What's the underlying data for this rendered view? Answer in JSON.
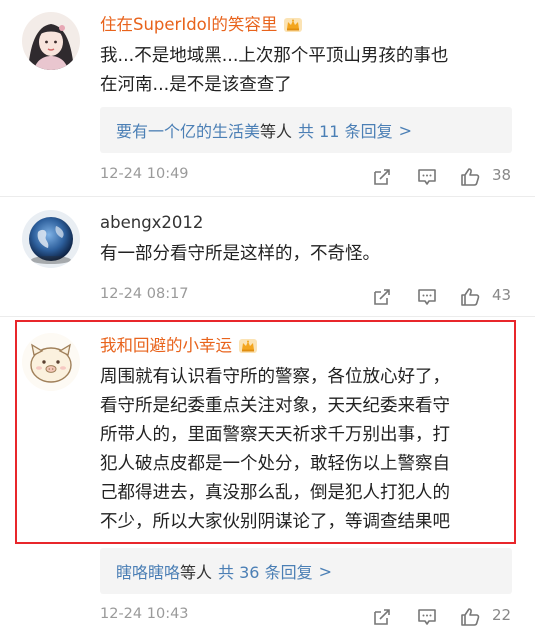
{
  "comments": [
    {
      "username": "住在SuperIdol的笑容里",
      "vip": true,
      "avatar_icon": "avatar-girl-illustration",
      "text_lines": [
        "我...不是地域黑...上次那个平顶山男孩的事也",
        "在河南...是不是该查查了"
      ],
      "replies": {
        "user": "要有一个亿的生活美",
        "mid": "等人",
        "count": "共 11 条回复",
        "arrow": ">"
      },
      "time": "12-24 10:49",
      "likes": "38"
    },
    {
      "username": "abengx2012",
      "vip": false,
      "avatar_icon": "avatar-earth-photo",
      "text_lines": [
        "有一部分看守所是这样的，不奇怪。"
      ],
      "time": "12-24 08:17",
      "likes": "43"
    },
    {
      "username": "我和回避的小幸运",
      "vip": true,
      "avatar_icon": "avatar-cartoon-pig",
      "text_lines": [
        "周围就有认识看守所的警察，各位放心好了，",
        "看守所是纪委重点关注对象，天天纪委来看守",
        "所带人的，里面警察天天祈求千万别出事，打",
        "犯人破点皮都是一个处分，敢轻伤以上警察自",
        "己都得进去，真没那么乱，倒是犯人打犯人的",
        "不少，所以大家伙别阴谋论了，等调查结果吧"
      ],
      "replies": {
        "user": "瞎咯瞎咯",
        "mid": "等人",
        "count": "共 36 条回复",
        "arrow": ">"
      },
      "time": "12-24 10:43",
      "likes": "22"
    }
  ],
  "colors": {
    "vip_name": "#e8631c",
    "reply_link": "#4b7fb5",
    "highlight_border": "#e8262b",
    "meta_text": "#9a9a9a"
  },
  "icons": [
    "crown-icon",
    "share-icon",
    "comment-icon",
    "like-icon"
  ]
}
